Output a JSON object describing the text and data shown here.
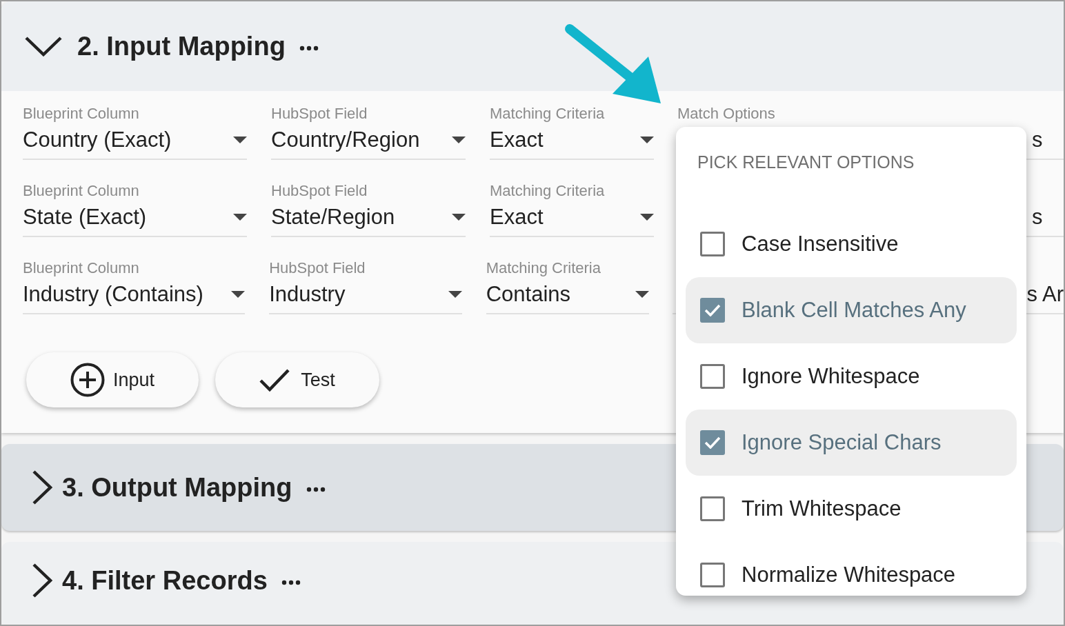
{
  "sections": [
    {
      "title": "2. Input Mapping",
      "expanded": true
    },
    {
      "title": "3. Output Mapping",
      "expanded": false
    },
    {
      "title": "4. Filter Records",
      "expanded": false
    }
  ],
  "mapping_rows": [
    {
      "fields": [
        {
          "label": "Blueprint Column",
          "value": "Country (Exact)"
        },
        {
          "label": "HubSpot Field",
          "value": "Country/Region"
        },
        {
          "label": "Matching Criteria",
          "value": "Exact"
        },
        {
          "label": "Match Options",
          "value": "s"
        }
      ]
    },
    {
      "fields": [
        {
          "label": "Blueprint Column",
          "value": "State (Exact)"
        },
        {
          "label": "HubSpot Field",
          "value": "State/Region"
        },
        {
          "label": "Matching Criteria",
          "value": "Exact"
        },
        {
          "value": "s"
        }
      ]
    },
    {
      "fields": [
        {
          "label": "Blueprint Column",
          "value": "Industry (Contains)"
        },
        {
          "label": "HubSpot Field",
          "value": "Industry"
        },
        {
          "label": "Matching Criteria",
          "value": "Contains"
        },
        {
          "value": "s Ar"
        }
      ]
    }
  ],
  "buttons": [
    {
      "label": "Input",
      "kind": "add"
    },
    {
      "label": "Test",
      "kind": "test"
    }
  ],
  "match_options_menu": {
    "heading": "PICK RELEVANT OPTIONS",
    "options": [
      {
        "label": "Case Insensitive",
        "checked": false
      },
      {
        "label": "Blank Cell Matches Any",
        "checked": true
      },
      {
        "label": "Ignore Whitespace",
        "checked": false
      },
      {
        "label": "Ignore Special Chars",
        "checked": true
      },
      {
        "label": "Trim Whitespace",
        "checked": false
      },
      {
        "label": "Normalize Whitespace",
        "checked": false
      }
    ]
  }
}
